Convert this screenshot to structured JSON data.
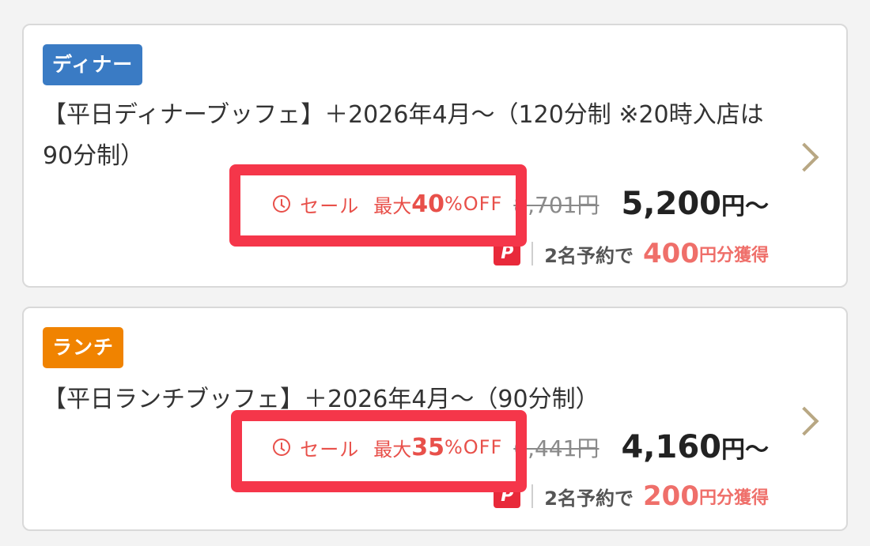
{
  "plans": [
    {
      "badge": "ディナー",
      "title": "【平日ディナーブッフェ】＋2026年4月～（120分制 ※20時入店は90分制）",
      "sale_label": "セール",
      "sale_max": "最大",
      "sale_pct": "40",
      "sale_off": "%OFF",
      "original_price": "8,701円",
      "price": "5,200",
      "price_suffix": "円～",
      "paypay_glyph": "P",
      "points_label": "2名予約で",
      "points_value": "400",
      "points_unit": "円分獲得"
    },
    {
      "badge": "ランチ",
      "title": "【平日ランチブッフェ】＋2026年4月～（90分制）",
      "sale_label": "セール",
      "sale_max": "最大",
      "sale_pct": "35",
      "sale_off": "%OFF",
      "original_price": "6,441円",
      "price": "4,160",
      "price_suffix": "円～",
      "paypay_glyph": "P",
      "points_label": "2名予約で",
      "points_value": "200",
      "points_unit": "円分獲得"
    }
  ],
  "colors": {
    "dinner_badge": "#3a7bc4",
    "lunch_badge": "#f08300",
    "sale_text": "#e8504a",
    "points_text": "#ef6f6a",
    "highlight": "#f5364a",
    "chevron": "#b8a783"
  }
}
